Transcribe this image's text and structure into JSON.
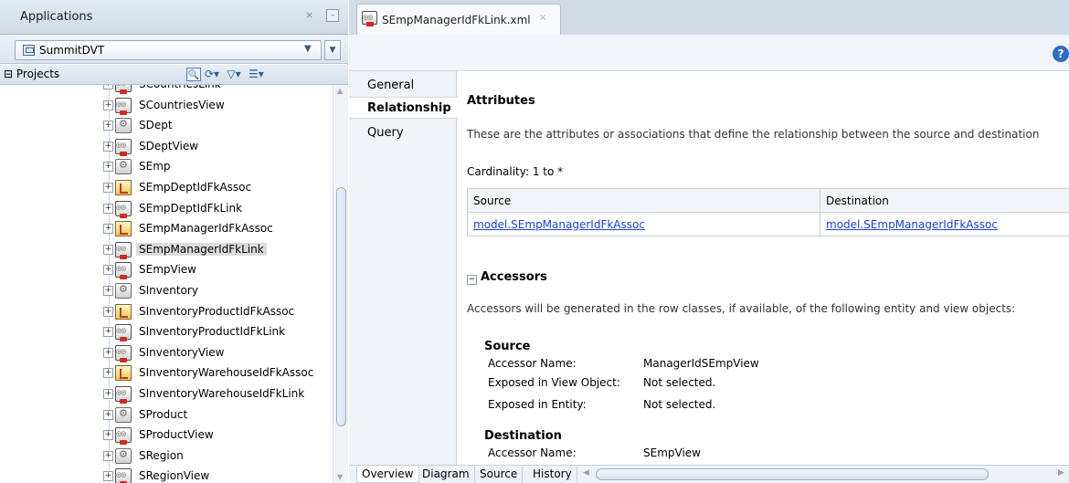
{
  "applications_panel": {
    "title": "Applications",
    "close_glyph": "×",
    "minimize_glyph": "–",
    "app_selector_value": "SummitDVT",
    "projects_label": "Projects",
    "tree_items": [
      {
        "label": "SCountriesLink",
        "type": "link"
      },
      {
        "label": "SCountriesView",
        "type": "view"
      },
      {
        "label": "SDept",
        "type": "entity"
      },
      {
        "label": "SDeptView",
        "type": "view"
      },
      {
        "label": "SEmp",
        "type": "entity"
      },
      {
        "label": "SEmpDeptIdFkAssoc",
        "type": "assoc"
      },
      {
        "label": "SEmpDeptIdFkLink",
        "type": "link"
      },
      {
        "label": "SEmpManagerIdFkAssoc",
        "type": "assoc"
      },
      {
        "label": "SEmpManagerIdFkLink",
        "type": "link",
        "selected": true
      },
      {
        "label": "SEmpView",
        "type": "view"
      },
      {
        "label": "SInventory",
        "type": "entity"
      },
      {
        "label": "SInventoryProductIdFkAssoc",
        "type": "assoc"
      },
      {
        "label": "SInventoryProductIdFkLink",
        "type": "link"
      },
      {
        "label": "SInventoryView",
        "type": "view"
      },
      {
        "label": "SInventoryWarehouseIdFkAssoc",
        "type": "assoc"
      },
      {
        "label": "SInventoryWarehouseIdFkLink",
        "type": "link"
      },
      {
        "label": "SProduct",
        "type": "entity"
      },
      {
        "label": "SProductView",
        "type": "view"
      },
      {
        "label": "SRegion",
        "type": "entity"
      },
      {
        "label": "SRegionView",
        "type": "view"
      }
    ]
  },
  "editor": {
    "tab_label": "SEmpManagerIdFkLink.xml",
    "tab_close_glyph": "×",
    "help_glyph": "?",
    "nav": [
      "General",
      "Relationship",
      "Query"
    ],
    "active_nav": "Relationship",
    "attributes_heading": "Attributes",
    "attributes_desc": "These are the attributes or associations that define the relationship between the source and destination",
    "cardinality_label": "Cardinality:",
    "cardinality_value": "1 to *",
    "table_headers": [
      "Source",
      "Destination"
    ],
    "table_row": [
      "model.SEmpManagerIdFkAssoc",
      "model.SEmpManagerIdFkAssoc"
    ],
    "accessors_heading": "Accessors",
    "accessors_toggle": "−",
    "accessors_desc": "Accessors will be generated in the row classes, if available, of the following entity and view objects:",
    "source": {
      "heading": "Source",
      "accessor_name_label": "Accessor Name:",
      "accessor_name_value": "ManagerIdSEmpView",
      "exposed_vo_label": "Exposed in View Object:",
      "exposed_vo_value": "Not selected.",
      "exposed_entity_label": "Exposed in Entity:",
      "exposed_entity_value": "Not selected."
    },
    "destination": {
      "heading": "Destination",
      "accessor_name_label": "Accessor Name:",
      "accessor_name_value": "SEmpView"
    },
    "bottom_tabs": [
      "Overview",
      "Diagram",
      "Source",
      "History"
    ],
    "active_bottom_tab": "Overview"
  }
}
